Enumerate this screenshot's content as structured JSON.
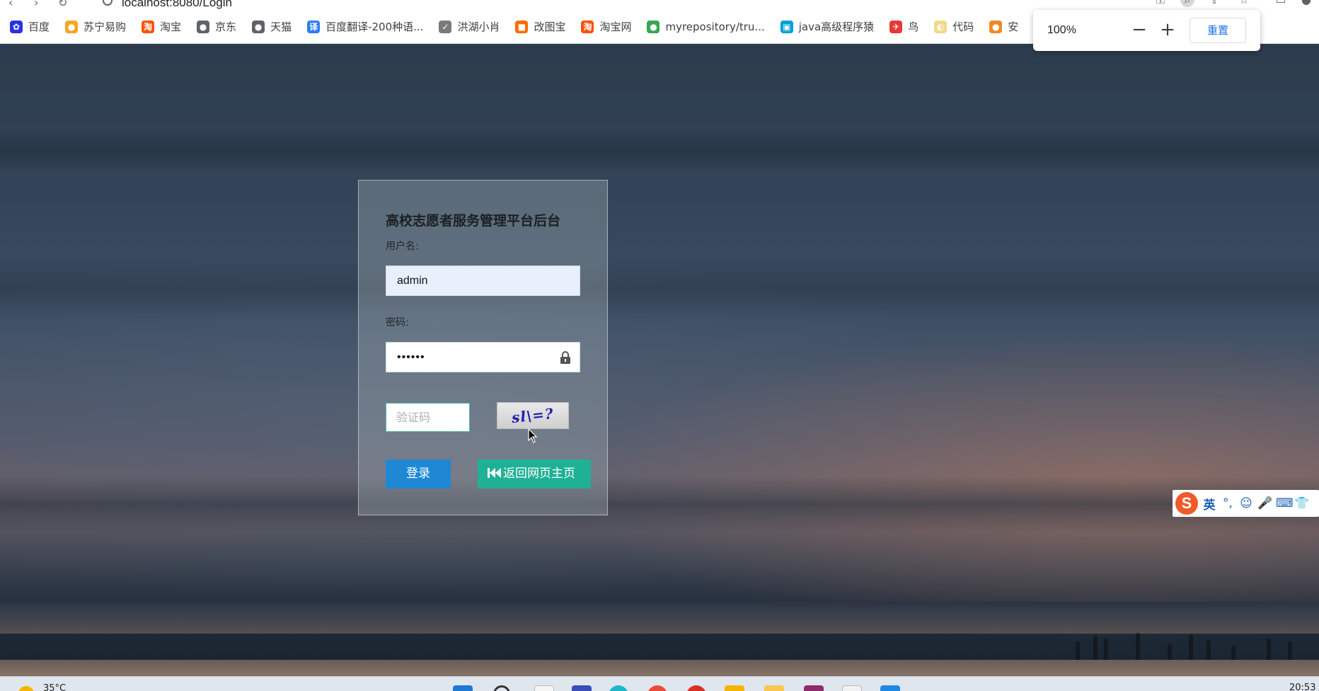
{
  "browser": {
    "url": "localhost:8080/Login",
    "zoom": {
      "level": "100%",
      "minus_label": "−",
      "plus_label": "+",
      "reset_label": "重置"
    },
    "bookmarks": [
      {
        "label": "百度",
        "icon": "baidu-paw-icon",
        "color": "#2932e1",
        "glyph": "✿"
      },
      {
        "label": "苏宁易购",
        "icon": "suning-lion-icon",
        "color": "#f6a623",
        "glyph": "●"
      },
      {
        "label": "淘宝",
        "icon": "taobao-icon",
        "color": "#ff5000",
        "glyph": "淘"
      },
      {
        "label": "京东",
        "icon": "globe-icon",
        "color": "#5f6368",
        "glyph": "●"
      },
      {
        "label": "天猫",
        "icon": "globe-icon",
        "color": "#5f6368",
        "glyph": "●"
      },
      {
        "label": "百度翻译-200种语...",
        "icon": "baidu-translate-icon",
        "color": "#2e7cf6",
        "glyph": "译"
      },
      {
        "label": "洪湖小肖",
        "icon": "bird-icon",
        "color": "#7a7a7a",
        "glyph": "✓"
      },
      {
        "label": "改图宝",
        "icon": "gaitubao-icon",
        "color": "#ff6a00",
        "glyph": "■"
      },
      {
        "label": "淘宝网",
        "icon": "taobao-icon",
        "color": "#ff5000",
        "glyph": "淘"
      },
      {
        "label": "myrepository/tru...",
        "icon": "chrome-icon",
        "color": "#34a853",
        "glyph": "●"
      },
      {
        "label": "java高级程序猿",
        "icon": "bilibili-icon",
        "color": "#00a1d6",
        "glyph": "▣"
      },
      {
        "label": "鸟",
        "icon": "bird-red-icon",
        "color": "#e53935",
        "glyph": "✈"
      },
      {
        "label": "代码",
        "icon": "code-icon",
        "color": "#f2d98a",
        "glyph": "◐"
      },
      {
        "label": "安",
        "icon": "orange-icon",
        "color": "#f08a24",
        "glyph": "●"
      }
    ]
  },
  "login": {
    "title": "高校志愿者服务管理平台后台",
    "username_label": "用户名:",
    "username_value": "admin",
    "password_label": "密码:",
    "password_value": "••••••",
    "captcha_placeholder": "验证码",
    "captcha_text": "sl\\=?",
    "login_button": "登录",
    "home_button": "返回网页主页"
  },
  "ime": {
    "logo": "S",
    "mode": "英",
    "items": [
      "°,",
      "☺",
      "🎤",
      "⌨",
      "👕"
    ]
  },
  "taskbar": {
    "temperature": "35°C",
    "time": "20:53"
  },
  "colors": {
    "login_button": "#1e88d4",
    "home_button": "#1fb195",
    "zoom_reset_text": "#1a73e8",
    "captcha_border": "#4fb8a8"
  }
}
